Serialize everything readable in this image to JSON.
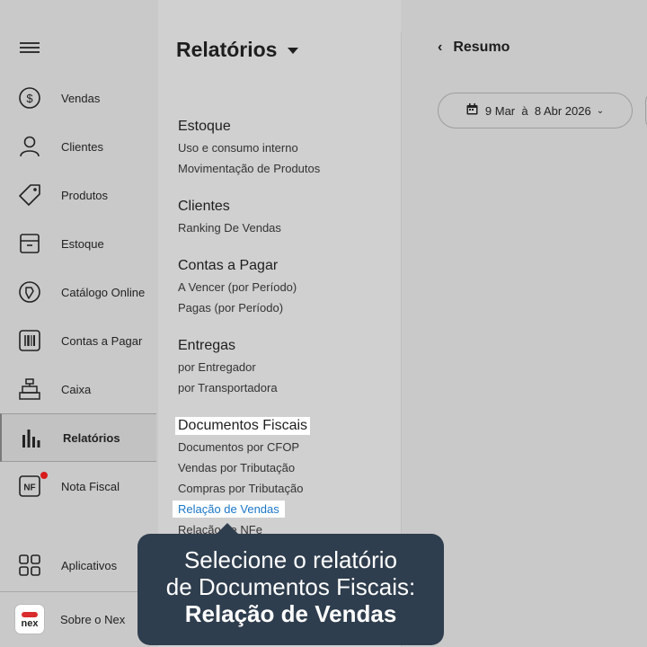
{
  "sidebar": {
    "items": [
      {
        "label": "Vendas",
        "icon": "dollar-circle-icon"
      },
      {
        "label": "Clientes",
        "icon": "user-icon"
      },
      {
        "label": "Produtos",
        "icon": "tag-icon"
      },
      {
        "label": "Estoque",
        "icon": "box-icon"
      },
      {
        "label": "Catálogo Online",
        "icon": "catalog-icon"
      },
      {
        "label": "Contas a Pagar",
        "icon": "barcode-icon"
      },
      {
        "label": "Caixa",
        "icon": "cash-register-icon"
      },
      {
        "label": "Relatórios",
        "icon": "bar-chart-icon"
      },
      {
        "label": "Nota Fiscal",
        "icon": "nf-icon",
        "badge_text": "NF"
      }
    ],
    "bottom": [
      {
        "label": "Aplicativos",
        "icon": "apps-grid-icon"
      },
      {
        "label": "Sobre o Nex",
        "icon": "nex-logo-icon",
        "logo_text": "nex"
      }
    ]
  },
  "reports": {
    "title": "Relatórios",
    "sections": [
      {
        "title": "Estoque",
        "links": [
          "Uso e consumo interno",
          "Movimentação de Produtos"
        ]
      },
      {
        "title": "Clientes",
        "links": [
          "Ranking De Vendas"
        ]
      },
      {
        "title": "Contas a Pagar",
        "links": [
          "A Vencer (por Período)",
          "Pagas (por Período)"
        ]
      },
      {
        "title": "Entregas",
        "links": [
          "por Entregador",
          "por Transportadora"
        ]
      },
      {
        "title": "Documentos Fiscais",
        "links": [
          "Documentos por CFOP",
          "Vendas por Tributação",
          "Compras por Tributação",
          "Relação de Vendas",
          "Relação de NFe"
        ]
      }
    ]
  },
  "main": {
    "back_label": "Resumo",
    "date_range": "9 Mar  à  8 Abr 2026"
  },
  "tooltip": {
    "line1": "Selecione o relatório",
    "line2": "de Documentos Fiscais:",
    "line3": "Relação de Vendas"
  },
  "colors": {
    "tooltip_bg": "#2f3e4e",
    "link_selected": "#1976c8",
    "badge_red": "#d81b1b"
  }
}
